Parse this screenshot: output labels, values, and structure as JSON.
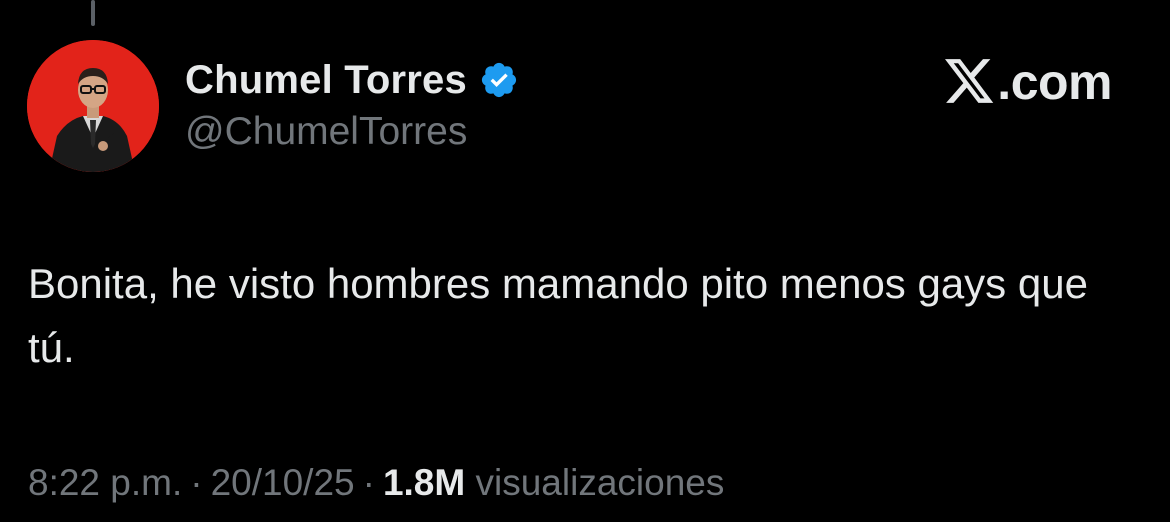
{
  "colors": {
    "background": "#000000",
    "primary_text": "#e7e9ea",
    "secondary_text": "#71767b",
    "verified_badge": "#1d9bf0",
    "avatar_background": "#e2231a"
  },
  "author": {
    "display_name": "Chumel Torres",
    "handle": "@ChumelTorres",
    "verified": true,
    "avatar_icon": "profile-photo"
  },
  "brand": {
    "icon": "x-logo-icon",
    "domain": ".com"
  },
  "tweet": {
    "text": "Bonita, he visto hombres mamando pito menos gays que tú."
  },
  "meta": {
    "time": "8:22 p.m.",
    "separator": "·",
    "date": "20/10/25",
    "views_count": "1.8M",
    "views_label": "visualizaciones"
  }
}
